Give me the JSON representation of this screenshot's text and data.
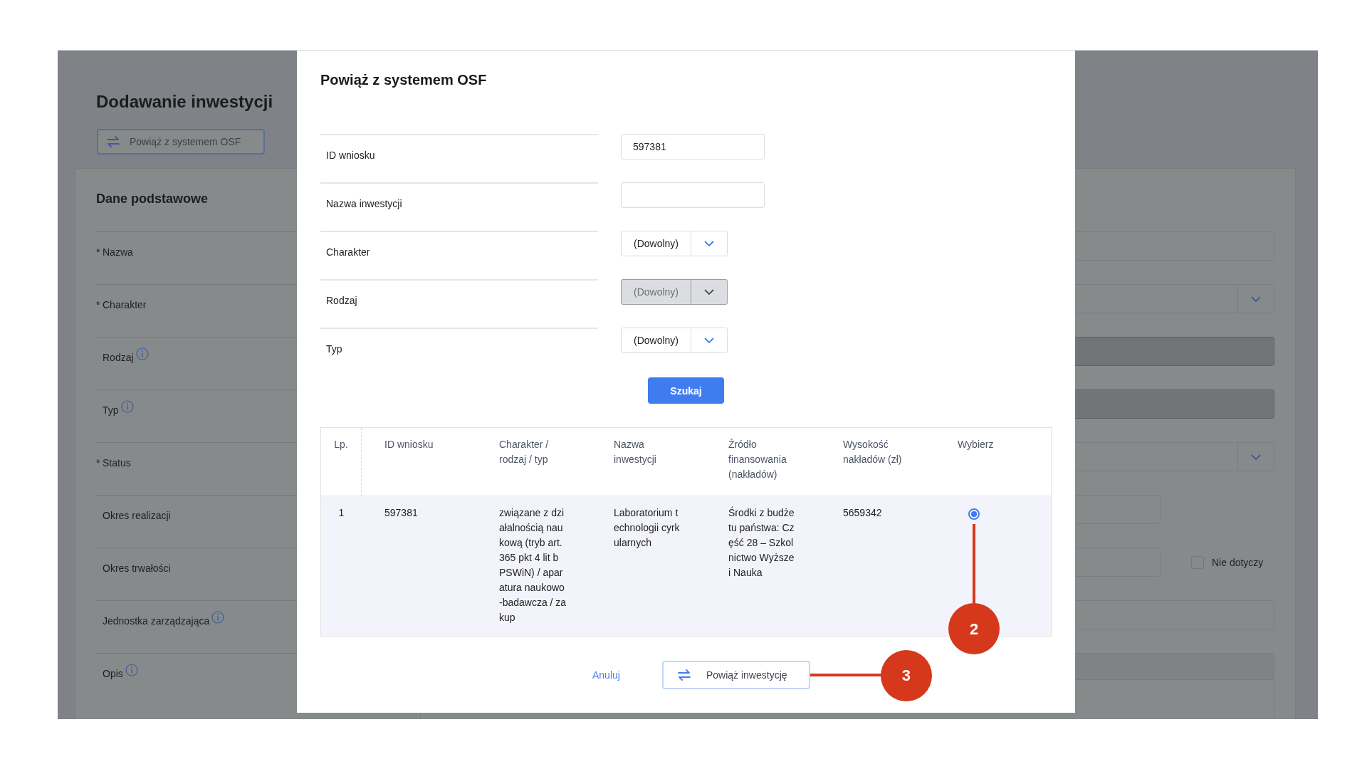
{
  "page": {
    "title": "Dodawanie inwestycji",
    "link_button": "Powiąż z systemem OSF",
    "section_title": "Dane podstawowe",
    "fields": [
      {
        "label": "Nazwa",
        "marker": "*",
        "info": false,
        "kind": "input"
      },
      {
        "label": "Charakter",
        "marker": "*",
        "info": false,
        "kind": "select"
      },
      {
        "label": "Rodzaj",
        "info": true,
        "kind": "disabled"
      },
      {
        "label": "Typ",
        "info": true,
        "kind": "disabled"
      },
      {
        "label": "Status",
        "marker": "*",
        "info": false,
        "kind": "select"
      },
      {
        "label": "Okres realizacji",
        "info": false,
        "kind": "short"
      },
      {
        "label": "Okres trwałości",
        "info": false,
        "kind": "short",
        "checkbox": {
          "label": "Nie dotyczy",
          "checked": false
        }
      },
      {
        "label": "Jednostka zarządzająca",
        "info": true,
        "kind": "input"
      },
      {
        "label": "Opis",
        "info": true,
        "kind": "textarea"
      }
    ]
  },
  "modal": {
    "title": "Powiąż z systemem OSF",
    "filters": [
      {
        "label": "ID wniosku",
        "kind": "input",
        "value": "597381"
      },
      {
        "label": "Nazwa inwestycji",
        "kind": "input"
      },
      {
        "label": "Charakter",
        "kind": "select",
        "value": "(Dowolny)",
        "disabled": false
      },
      {
        "label": "Rodzaj",
        "kind": "select",
        "value": "(Dowolny)",
        "disabled": true
      },
      {
        "label": "Typ",
        "kind": "select",
        "value": "(Dowolny)",
        "disabled": false
      }
    ],
    "search_button": "Szukaj",
    "table": {
      "columns": [
        "Lp.",
        "ID wniosku",
        "Charakter / rodzaj / typ",
        "Nazwa inwestycji",
        "Źródło finansowania (nakładów)",
        "Wysokość nakładów (zł)",
        "Wybierz"
      ],
      "rows": [
        {
          "cells": [
            "1",
            "597381",
            "związane z działalnością naukową (tryb art. 365 pkt 4 lit b PSWiN) / aparatura naukowo-badawcza / zakup",
            "Laboratorium technologii cyrkularnych",
            "Środki z budżetu państwa: Część 28 – Szkolnictwo Wyższe i Nauka",
            "5659342"
          ],
          "selected": true
        }
      ]
    },
    "cancel": "Anuluj",
    "confirm": "Powiąż inwestycję"
  },
  "annotations": [
    {
      "label": "2"
    },
    {
      "label": "3"
    }
  ]
}
